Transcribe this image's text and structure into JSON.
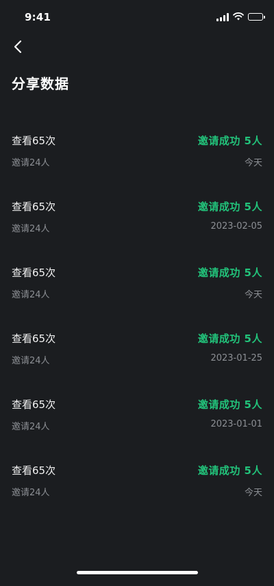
{
  "status_bar": {
    "time": "9:41",
    "icons": [
      "signal-icon",
      "wifi-icon",
      "battery-icon"
    ]
  },
  "header": {
    "back_icon": "chevron-left-icon",
    "title": "分享数据"
  },
  "colors": {
    "background": "#1b1d20",
    "accent": "#22c27a",
    "secondary_text": "#8c8f94"
  },
  "records": [
    {
      "views": "查看65次",
      "success": "邀请成功 5人",
      "invited": "邀请24人",
      "date": "今天"
    },
    {
      "views": "查看65次",
      "success": "邀请成功 5人",
      "invited": "邀请24人",
      "date": "2023-02-05"
    },
    {
      "views": "查看65次",
      "success": "邀请成功 5人",
      "invited": "邀请24人",
      "date": "今天"
    },
    {
      "views": "查看65次",
      "success": "邀请成功 5人",
      "invited": "邀请24人",
      "date": "2023-01-25"
    },
    {
      "views": "查看65次",
      "success": "邀请成功 5人",
      "invited": "邀请24人",
      "date": "2023-01-01"
    },
    {
      "views": "查看65次",
      "success": "邀请成功 5人",
      "invited": "邀请24人",
      "date": "今天"
    }
  ]
}
